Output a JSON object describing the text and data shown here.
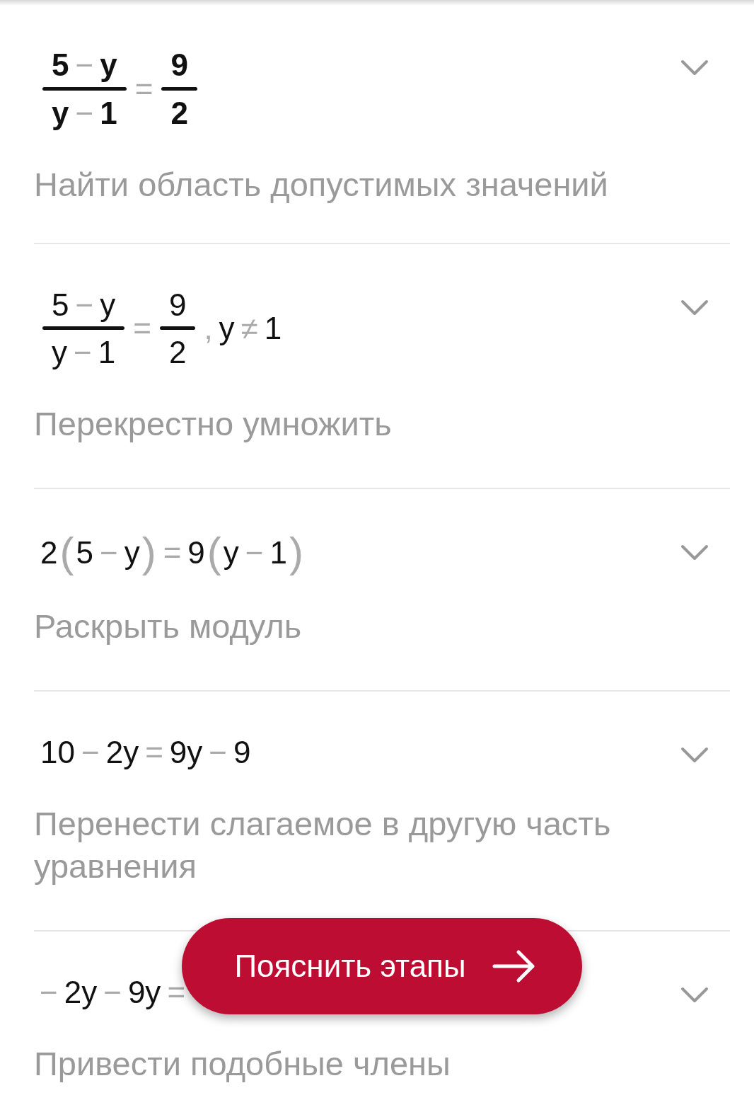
{
  "steps": [
    {
      "bold": true,
      "expanded": false,
      "expression": [
        {
          "kind": "frac",
          "num": [
            {
              "kind": "num",
              "text": "5"
            },
            {
              "kind": "op",
              "text": "−"
            },
            {
              "kind": "num",
              "text": "y"
            }
          ],
          "den": [
            {
              "kind": "num",
              "text": "y"
            },
            {
              "kind": "op",
              "text": "−"
            },
            {
              "kind": "num",
              "text": "1"
            }
          ]
        },
        {
          "kind": "op",
          "text": "="
        },
        {
          "kind": "frac",
          "num": [
            {
              "kind": "num",
              "text": "9"
            }
          ],
          "den": [
            {
              "kind": "num",
              "text": "2"
            }
          ]
        }
      ],
      "description": "Найти область допустимых значений"
    },
    {
      "bold": false,
      "expanded": false,
      "expression": [
        {
          "kind": "frac",
          "num": [
            {
              "kind": "num",
              "text": "5"
            },
            {
              "kind": "op",
              "text": "−"
            },
            {
              "kind": "num",
              "text": "y"
            }
          ],
          "den": [
            {
              "kind": "num",
              "text": "y"
            },
            {
              "kind": "op",
              "text": "−"
            },
            {
              "kind": "num",
              "text": "1"
            }
          ]
        },
        {
          "kind": "op",
          "text": "="
        },
        {
          "kind": "frac",
          "num": [
            {
              "kind": "num",
              "text": "9"
            }
          ],
          "den": [
            {
              "kind": "num",
              "text": "2"
            }
          ]
        },
        {
          "kind": "op",
          "text": ","
        },
        {
          "kind": "num",
          "text": "y"
        },
        {
          "kind": "op",
          "text": "≠"
        },
        {
          "kind": "num",
          "text": "1"
        }
      ],
      "description": "Перекрестно умножить"
    },
    {
      "bold": false,
      "expanded": false,
      "expression": [
        {
          "kind": "num",
          "text": "2"
        },
        {
          "kind": "paren",
          "text": "("
        },
        {
          "kind": "num",
          "text": "5"
        },
        {
          "kind": "op",
          "text": "−"
        },
        {
          "kind": "num",
          "text": "y"
        },
        {
          "kind": "paren",
          "text": ")"
        },
        {
          "kind": "op",
          "text": "="
        },
        {
          "kind": "num",
          "text": "9"
        },
        {
          "kind": "paren",
          "text": "("
        },
        {
          "kind": "num",
          "text": "y"
        },
        {
          "kind": "op",
          "text": "−"
        },
        {
          "kind": "num",
          "text": "1"
        },
        {
          "kind": "paren",
          "text": ")"
        }
      ],
      "description": "Раскрыть модуль"
    },
    {
      "bold": false,
      "expanded": false,
      "expression": [
        {
          "kind": "num",
          "text": "10"
        },
        {
          "kind": "op",
          "text": "−"
        },
        {
          "kind": "num",
          "text": "2y"
        },
        {
          "kind": "op",
          "text": "="
        },
        {
          "kind": "num",
          "text": "9y"
        },
        {
          "kind": "op",
          "text": "−"
        },
        {
          "kind": "num",
          "text": "9"
        }
      ],
      "description": "Перенести слагаемое в другую часть уравнения"
    },
    {
      "bold": false,
      "expanded": false,
      "expression": [
        {
          "kind": "op",
          "text": "−"
        },
        {
          "kind": "num",
          "text": "2y"
        },
        {
          "kind": "op",
          "text": "−"
        },
        {
          "kind": "num",
          "text": "9y"
        },
        {
          "kind": "op",
          "text": "="
        }
      ],
      "description": "Привести подобные члены"
    }
  ],
  "action_button": {
    "label": "Пояснить этапы"
  }
}
